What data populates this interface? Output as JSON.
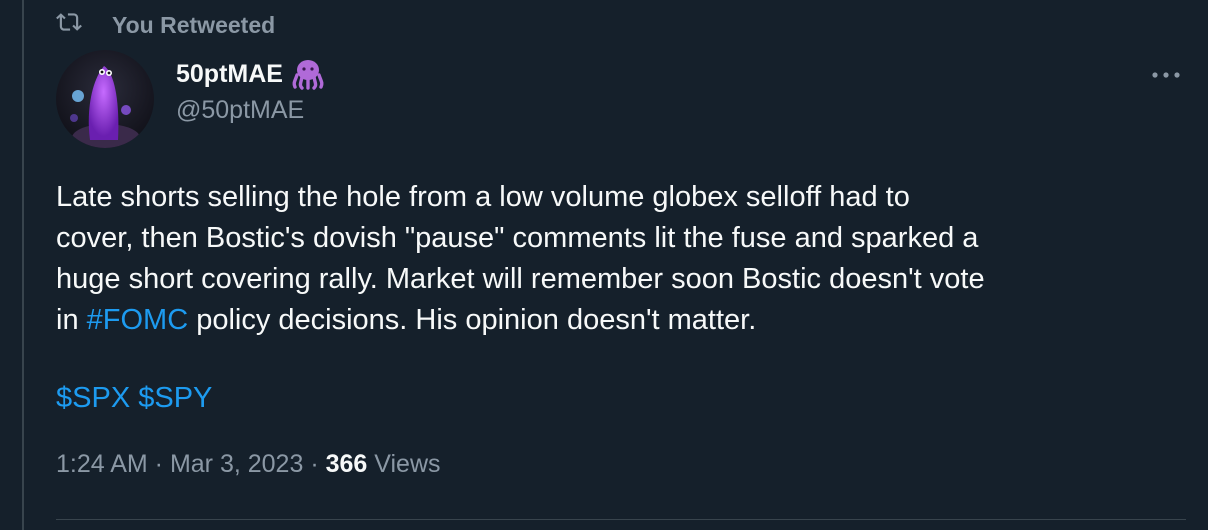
{
  "retweet": {
    "label": "You Retweeted",
    "icon": "retweet-icon"
  },
  "author": {
    "display_name": "50ptMAE",
    "emoji": "octopus-emoji",
    "handle": "@50ptMAE",
    "avatar": "avatar-image"
  },
  "tweet": {
    "text_before_hashtag": "Late shorts selling the hole from a low volume globex selloff had to\ncover, then Bostic's dovish \"pause\" comments lit the fuse and sparked a\nhuge short covering rally. Market will remember soon Bostic doesn't vote\nin ",
    "hashtag": "#FOMC",
    "text_after_hashtag": " policy decisions. His opinion doesn't matter.",
    "cashtags": [
      "$SPX",
      "$SPY"
    ]
  },
  "meta": {
    "time": "1:24 AM",
    "separator": " · ",
    "date": "Mar 3, 2023",
    "views_count": "366",
    "views_label": " Views"
  },
  "colors": {
    "background": "#15202b",
    "text": "#f7f9f9",
    "secondary": "#8b98a5",
    "link": "#1d9bf0",
    "border": "#38444d"
  }
}
